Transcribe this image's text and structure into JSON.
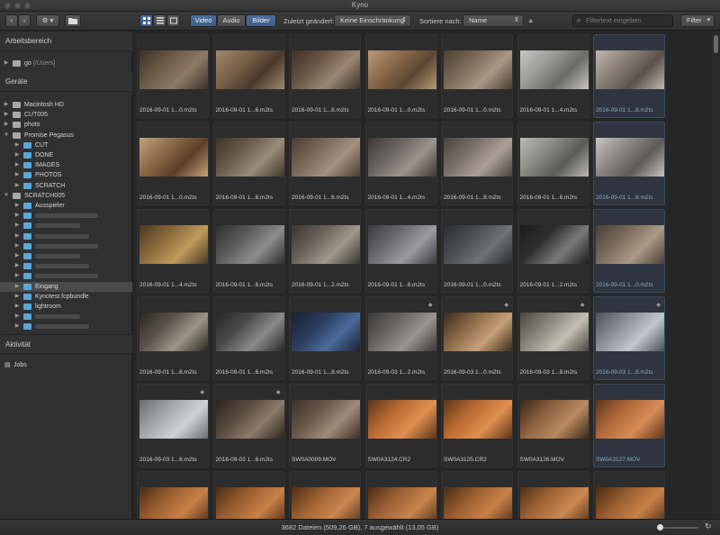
{
  "window": {
    "title": "Kyno"
  },
  "toolbar": {
    "back_icon": "chevron-left-icon",
    "forward_icon": "chevron-right-icon",
    "settings_icon": "gear-icon",
    "folder_icon": "folder-icon",
    "view_grid_icon": "grid-view-icon",
    "view_list_icon": "list-view-icon",
    "view_single_icon": "single-view-icon",
    "filter_tabs": [
      "Video",
      "Audio",
      "Bilder"
    ],
    "modified_label": "Zuletzt geändert:",
    "modified_value": "Keine Einschränkung",
    "sort_label": "Sortiere nach:",
    "sort_value": "Name",
    "sort_direction_icon": "triangle-up-icon",
    "search_placeholder": "Filtertext eingeben",
    "filter_button": "Filter"
  },
  "sidebar": {
    "workspace_header": "Arbeitsbereich",
    "workspace_item": {
      "label": "go",
      "path": "[/Users]"
    },
    "devices_header": "Geräte",
    "tree": [
      {
        "label": "Macintosh HD",
        "level": 0,
        "kind": "drive",
        "expanded": false
      },
      {
        "label": "CUT005",
        "level": 0,
        "kind": "drive",
        "expanded": false
      },
      {
        "label": "photo",
        "level": 0,
        "kind": "drive",
        "expanded": false
      },
      {
        "label": "Promise Pegasus",
        "level": 0,
        "kind": "drive",
        "expanded": true
      },
      {
        "label": "CUT",
        "level": 1,
        "kind": "folder",
        "expanded": false
      },
      {
        "label": "DONE",
        "level": 1,
        "kind": "folder",
        "expanded": false
      },
      {
        "label": "IMAGES",
        "level": 1,
        "kind": "folder",
        "expanded": false
      },
      {
        "label": "PHOTOS",
        "level": 1,
        "kind": "folder",
        "expanded": false
      },
      {
        "label": "SCRATCH",
        "level": 1,
        "kind": "folder",
        "expanded": false
      },
      {
        "label": "SCRATCH005",
        "level": 0,
        "kind": "drive",
        "expanded": true
      },
      {
        "label": "Ausspieler",
        "level": 1,
        "kind": "folder",
        "expanded": false
      },
      {
        "label": "",
        "level": 1,
        "kind": "folder",
        "expanded": false,
        "blurred": true
      },
      {
        "label": "",
        "level": 1,
        "kind": "folder",
        "expanded": false,
        "blurred": true
      },
      {
        "label": "",
        "level": 1,
        "kind": "folder",
        "expanded": false,
        "blurred": true
      },
      {
        "label": "",
        "level": 1,
        "kind": "folder",
        "expanded": false,
        "blurred": true
      },
      {
        "label": "",
        "level": 1,
        "kind": "folder",
        "expanded": false,
        "blurred": true
      },
      {
        "label": "",
        "level": 1,
        "kind": "folder",
        "expanded": false,
        "blurred": true
      },
      {
        "label": "",
        "level": 1,
        "kind": "folder",
        "expanded": false,
        "blurred": true
      },
      {
        "label": "Eingang",
        "level": 1,
        "kind": "folder",
        "expanded": false,
        "selected": true
      },
      {
        "label": "Kynotest.fcpbundle",
        "level": 1,
        "kind": "folder",
        "expanded": false
      },
      {
        "label": "lightroom",
        "level": 1,
        "kind": "folder",
        "expanded": false
      },
      {
        "label": "",
        "level": 1,
        "kind": "folder",
        "expanded": false,
        "blurred": true
      },
      {
        "label": "",
        "level": 1,
        "kind": "folder",
        "expanded": false,
        "blurred": true
      }
    ],
    "activity_header": "Aktivität",
    "jobs_label": "Jobs"
  },
  "grid": {
    "items": [
      {
        "label": "2016-09-01 1...0.m2ts",
        "thumb": [
          "#6b5a44",
          "#8c7a66",
          "#3a3028"
        ]
      },
      {
        "label": "2016-09-01 1...6.m2ts",
        "thumb": [
          "#7a6248",
          "#4a3a2c",
          "#a08870"
        ]
      },
      {
        "label": "2016-09-01 1...6.m2ts",
        "thumb": [
          "#6a5644",
          "#9a8874",
          "#3c3026"
        ]
      },
      {
        "label": "2016-09-01 1...0.m2ts",
        "thumb": [
          "#8a6a4a",
          "#5a4634",
          "#b89a78"
        ]
      },
      {
        "label": "2016-09-01 1...0.m2ts",
        "thumb": [
          "#7c6a58",
          "#a89884",
          "#4a3e32"
        ]
      },
      {
        "label": "2016-09-01 1...4.m2ts",
        "thumb": [
          "#9a9a96",
          "#6a6a66",
          "#c8c6c0"
        ]
      },
      {
        "label": "2016-09-01 1...8.m2ts",
        "selected": true,
        "thumb": [
          "#8a8076",
          "#5a524a",
          "#c0b8ac"
        ]
      },
      {
        "label": "2016-09-01 1...0.m2ts",
        "thumb": [
          "#8a6a48",
          "#5c3e28",
          "#c4a27c"
        ]
      },
      {
        "label": "2016-09-01 1...6.m2ts",
        "thumb": [
          "#6a5c4c",
          "#9a8c7a",
          "#3e342a"
        ]
      },
      {
        "label": "2016-09-01 1...6.m2ts",
        "thumb": [
          "#7a6858",
          "#a49280",
          "#4a3c30"
        ]
      },
      {
        "label": "2016-09-01 1...4.m2ts",
        "thumb": [
          "#6c6460",
          "#9c948c",
          "#3c3632"
        ]
      },
      {
        "label": "2016-09-01 1...8.m2ts",
        "thumb": [
          "#7a706a",
          "#aaa098",
          "#4a423e"
        ]
      },
      {
        "label": "2016-09-01 1...6.m2ts",
        "thumb": [
          "#8a8a86",
          "#5a5a58",
          "#bcbab4"
        ]
      },
      {
        "label": "2016-09-01 1...8.m2ts",
        "selected": true,
        "thumb": [
          "#8c8884",
          "#5c5a56",
          "#c8c4be"
        ]
      },
      {
        "label": "2016-09-01 1...4.m2ts",
        "thumb": [
          "#8a6a3c",
          "#c09a5c",
          "#4a3620"
        ]
      },
      {
        "label": "2016-09-01 1...6.m2ts",
        "thumb": [
          "#5a5a5a",
          "#8c8c8c",
          "#2e2e2e"
        ]
      },
      {
        "label": "2016-09-01 1...2.m2ts",
        "thumb": [
          "#6a625a",
          "#a09888",
          "#383430"
        ]
      },
      {
        "label": "2016-09-01 1...8.m2ts",
        "thumb": [
          "#6a6a6e",
          "#9a9aa0",
          "#3a3a3e"
        ]
      },
      {
        "label": "2016-09-01 1...0.m2ts",
        "thumb": [
          "#4a4e54",
          "#6e7278",
          "#2a2c30"
        ]
      },
      {
        "label": "2016-09-01 1...2.m2ts",
        "thumb": [
          "#2e2e2e",
          "#7a7a7a",
          "#1c1c1c"
        ]
      },
      {
        "label": "2016-09-01 1...0.m2ts",
        "selected": true,
        "thumb": [
          "#7a6a5a",
          "#aa9a86",
          "#4a3e34"
        ]
      },
      {
        "label": "2016-09-01 1...6.m2ts",
        "thumb": [
          "#5a5248",
          "#9c9486",
          "#2a2620"
        ]
      },
      {
        "label": "2016-09-01 1...6.m2ts",
        "thumb": [
          "#4a4a4a",
          "#8a8a8a",
          "#262626"
        ]
      },
      {
        "label": "2016-09-01 1...8.m2ts",
        "thumb": [
          "#2a3a5a",
          "#4a6a9a",
          "#1a2236"
        ]
      },
      {
        "label": "2016-09-03 1...2.m2ts",
        "tagged": true,
        "thumb": [
          "#6a6460",
          "#9a948e",
          "#3a3634"
        ]
      },
      {
        "label": "2016-09-03 1...0.m2ts",
        "tagged": true,
        "thumb": [
          "#8a6a48",
          "#c8a078",
          "#3a2a1c"
        ]
      },
      {
        "label": "2016-09-03 1...8.m2ts",
        "tagged": true,
        "thumb": [
          "#8a847a",
          "#c4beb2",
          "#4a4640"
        ]
      },
      {
        "label": "2016-09-03 1...6.m2ts",
        "selected": true,
        "tagged": true,
        "thumb": [
          "#8a9098",
          "#c0c6cc",
          "#4a5058"
        ]
      },
      {
        "label": "2016-09-03 1...6.m2ts",
        "tagged": true,
        "thumb": [
          "#a4a6a8",
          "#d0d2d4",
          "#6a6c6e"
        ]
      },
      {
        "label": "2016-09-03 1...6.m2ts",
        "tagged": true,
        "thumb": [
          "#5a4a3e",
          "#8a7a6a",
          "#2a221c"
        ]
      },
      {
        "label": "SW0A0009.MOV",
        "thumb": [
          "#6a5648",
          "#a08a78",
          "#3a2e26"
        ]
      },
      {
        "label": "SW0A3124.CR2",
        "thumb": [
          "#b86a32",
          "#e09050",
          "#5a3418"
        ]
      },
      {
        "label": "SW0A3125.CR2",
        "thumb": [
          "#b86a32",
          "#e09050",
          "#5a3418"
        ]
      },
      {
        "label": "SW0A3126.MOV",
        "thumb": [
          "#8a6040",
          "#b88a60",
          "#3a2818"
        ]
      },
      {
        "label": "SW0A3127.MOV",
        "selected": true,
        "thumb": [
          "#b0683a",
          "#d88c56",
          "#5a3418"
        ]
      },
      {
        "label": "",
        "thumb": [
          "#9a5e30",
          "#c88048",
          "#4a2c14"
        ]
      },
      {
        "label": "",
        "thumb": [
          "#9a5e30",
          "#c88048",
          "#4a2c14"
        ]
      },
      {
        "label": "",
        "thumb": [
          "#a06232",
          "#cc8650",
          "#4e2e16"
        ]
      },
      {
        "label": "",
        "thumb": [
          "#9c6034",
          "#c8844e",
          "#4a2c16"
        ]
      },
      {
        "label": "",
        "thumb": [
          "#9a5e30",
          "#c88048",
          "#4a2c14"
        ]
      },
      {
        "label": "",
        "thumb": [
          "#a06434",
          "#cc8852",
          "#4e3018"
        ]
      },
      {
        "label": "",
        "thumb": [
          "#9a5e30",
          "#c88048",
          "#4a2c14"
        ]
      }
    ]
  },
  "status": {
    "text": "3682 Dateien (509,26 GB), 7 ausgewählt (13,05 GB)",
    "refresh_icon": "refresh-icon"
  }
}
